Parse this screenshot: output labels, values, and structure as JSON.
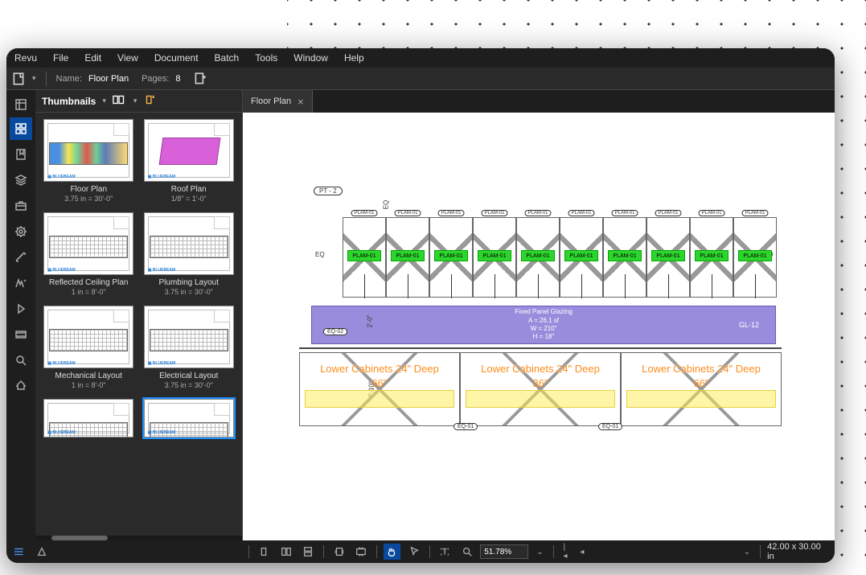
{
  "menu": [
    "Revu",
    "File",
    "Edit",
    "View",
    "Document",
    "Batch",
    "Tools",
    "Window",
    "Help"
  ],
  "quick": {
    "nameLabel": "Name:",
    "nameVal": "Floor Plan",
    "pagesLabel": "Pages:",
    "pagesVal": "8"
  },
  "thumbnails": {
    "title": "Thumbnails",
    "items": [
      {
        "label": "Floor Plan",
        "scale": "3.75 in = 30'-0\"",
        "type": "colorful"
      },
      {
        "label": "Roof Plan",
        "scale": "1/8\" = 1'-0\"",
        "type": "pink"
      },
      {
        "label": "Reflected Ceiling Plan",
        "scale": "1 in = 8'-0\"",
        "type": "lines"
      },
      {
        "label": "Plumbing Layout",
        "scale": "3.75 in = 30'-0\"",
        "type": "lines"
      },
      {
        "label": "Mechanical Layout",
        "scale": "1 in = 8'-0\"",
        "type": "lines"
      },
      {
        "label": "Electrical Layout",
        "scale": "3.75 in = 30'-0\"",
        "type": "lines"
      },
      {
        "label": "",
        "scale": "",
        "type": "lines",
        "partial": true
      },
      {
        "label": "",
        "scale": "",
        "type": "lines",
        "partial": true,
        "selected": true
      }
    ]
  },
  "docTab": {
    "label": "Floor Plan"
  },
  "drawing": {
    "pt2": "PT - 2",
    "eq": "EQ",
    "plamTag": "PLAM-01",
    "plamGreen": "PLAM-01",
    "glazing": {
      "l1": "Fixed Panel Glazing",
      "l2": "A = 26.1 sf",
      "l3": "W = 210\"",
      "l4": "H = 18\"",
      "gl": "GL-12"
    },
    "lowerLabel": "Lower Cabinets 24\" Deep",
    "lowerHeights": [
      "66\"",
      "36\"",
      "66\""
    ],
    "eq01": "EQ-01",
    "eq02": "EQ-02",
    "dim210": "2'-0\"",
    "dim218": "2'-10\""
  },
  "status": {
    "zoom": "51.78%",
    "dims": "42.00 x 30.00 in"
  }
}
